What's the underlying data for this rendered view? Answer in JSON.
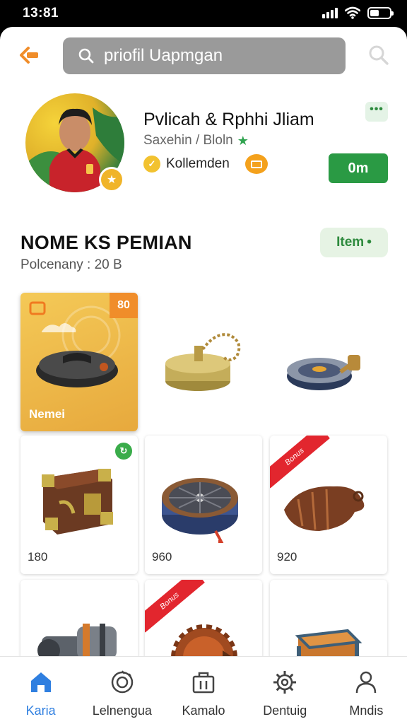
{
  "status": {
    "time": "13:81"
  },
  "header": {
    "search_value": "priofil Uapmgan"
  },
  "profile": {
    "name": "Pvlicah & Rphhi Jliam",
    "subtitle": "Saxehin / Bloln",
    "clan": "Kollemden",
    "action_label": "0m",
    "more_label": "•••"
  },
  "section": {
    "title": "NOME KS PEMIAN",
    "subtitle": "Polcenany : 20 B",
    "filter_label": "Item",
    "filter_suffix": "•"
  },
  "items": [
    {
      "name": "featured-item",
      "price": "Nemei",
      "tag": "80"
    },
    {
      "name": "brass-compass-item",
      "price": ""
    },
    {
      "name": "disc-tool-item",
      "price": ""
    },
    {
      "name": "treasure-chest-item",
      "price": "180",
      "tag": "S"
    },
    {
      "name": "shield-drum-item",
      "price": "960"
    },
    {
      "name": "leather-horn-item",
      "price": "920",
      "ribbon": "Bonus"
    },
    {
      "name": "cannon-item",
      "price": ""
    },
    {
      "name": "bronze-orb-item",
      "price": "",
      "ribbon": "Bonus"
    },
    {
      "name": "wood-crate-item",
      "price": ""
    }
  ],
  "nav": [
    {
      "label": "Karia",
      "icon": "home-icon"
    },
    {
      "label": "Lelnengua",
      "icon": "ring-icon"
    },
    {
      "label": "Kamalo",
      "icon": "bag-icon"
    },
    {
      "label": "Dentuig",
      "icon": "gear-icon"
    },
    {
      "label": "Mndis",
      "icon": "person-icon"
    }
  ],
  "colors": {
    "accent_green": "#2a9a44",
    "active_blue": "#2f7fe0",
    "orange": "#f08d2a",
    "ribbon_red": "#e2262e"
  }
}
